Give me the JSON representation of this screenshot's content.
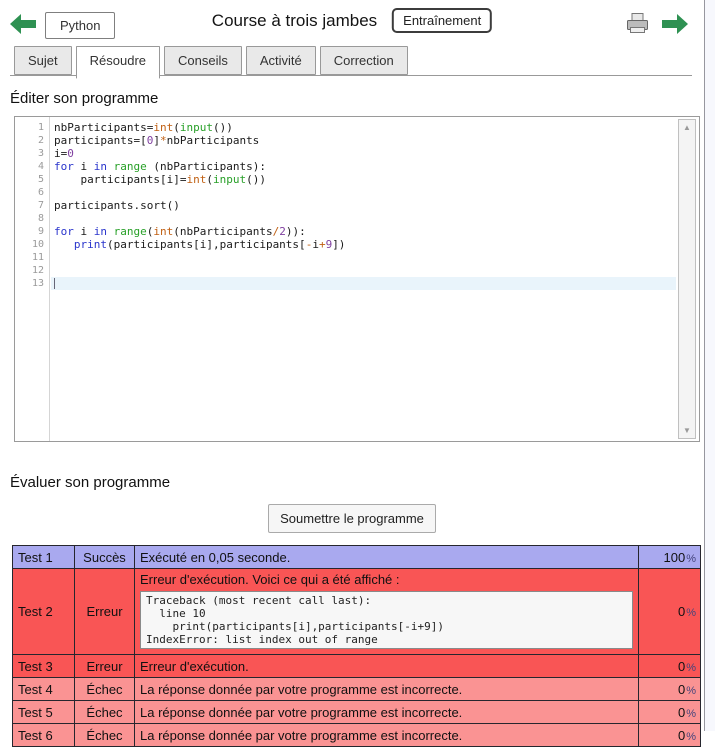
{
  "header": {
    "python_label": "Python",
    "title": "Course à trois jambes",
    "badge": "Entraînement"
  },
  "tabs": [
    {
      "label": "Sujet",
      "active": false
    },
    {
      "label": "Résoudre",
      "active": true
    },
    {
      "label": "Conseils",
      "active": false
    },
    {
      "label": "Activité",
      "active": false
    },
    {
      "label": "Correction",
      "active": false
    }
  ],
  "sections": {
    "edit": "Éditer son programme",
    "evaluate": "Évaluer son programme"
  },
  "editor": {
    "active_line": 13,
    "scroll_up": "▲",
    "scroll_down": "▼",
    "lines": [
      [
        [
          "pl",
          "nbParticipants="
        ],
        [
          "ty",
          "int"
        ],
        [
          "pl",
          "("
        ],
        [
          "fn",
          "input"
        ],
        [
          "pl",
          "())"
        ]
      ],
      [
        [
          "pl",
          "participants=["
        ],
        [
          "nu",
          "0"
        ],
        [
          "pl",
          "]"
        ],
        [
          "op",
          "*"
        ],
        [
          "pl",
          "nbParticipants"
        ]
      ],
      [
        [
          "pl",
          "i="
        ],
        [
          "nu",
          "0"
        ]
      ],
      [
        [
          "kw",
          "for"
        ],
        [
          "pl",
          " i "
        ],
        [
          "kw",
          "in"
        ],
        [
          "pl",
          " "
        ],
        [
          "fn",
          "range"
        ],
        [
          "pl",
          " (nbParticipants):"
        ]
      ],
      [
        [
          "pl",
          "    participants[i]="
        ],
        [
          "ty",
          "int"
        ],
        [
          "pl",
          "("
        ],
        [
          "fn",
          "input"
        ],
        [
          "pl",
          "())"
        ]
      ],
      [],
      [
        [
          "pl",
          "participants.sort()"
        ]
      ],
      [],
      [
        [
          "kw",
          "for"
        ],
        [
          "pl",
          " i "
        ],
        [
          "kw",
          "in"
        ],
        [
          "pl",
          " "
        ],
        [
          "fn",
          "range"
        ],
        [
          "pl",
          "("
        ],
        [
          "ty",
          "int"
        ],
        [
          "pl",
          "(nbParticipants"
        ],
        [
          "op",
          "/"
        ],
        [
          "nu",
          "2"
        ],
        [
          "pl",
          ")):"
        ]
      ],
      [
        [
          "pl",
          "   "
        ],
        [
          "kw",
          "print"
        ],
        [
          "pl",
          "(participants[i],participants["
        ],
        [
          "op",
          "-"
        ],
        [
          "pl",
          "i"
        ],
        [
          "op",
          "+"
        ],
        [
          "nu",
          "9"
        ],
        [
          "pl",
          "])"
        ]
      ],
      [],
      [],
      []
    ]
  },
  "submit_button": "Soumettre le programme",
  "results": {
    "percent_sign": "%",
    "rows": [
      {
        "test": "Test 1",
        "status": "Succès",
        "type": "success",
        "message": "Exécuté en 0,05 seconde.",
        "score": "100"
      },
      {
        "test": "Test 2",
        "status": "Erreur",
        "type": "error",
        "message": "Erreur d'exécution. Voici ce qui a été affiché :",
        "traceback": [
          "Traceback (most recent call last):",
          "  line 10",
          "    print(participants[i],participants[-i+9])",
          "IndexError: list index out of range"
        ],
        "score": "0"
      },
      {
        "test": "Test 3",
        "status": "Erreur",
        "type": "error",
        "message": "Erreur d'exécution.",
        "score": "0"
      },
      {
        "test": "Test 4",
        "status": "Échec",
        "type": "failure",
        "message": "La réponse donnée par votre programme est incorrecte.",
        "score": "0"
      },
      {
        "test": "Test 5",
        "status": "Échec",
        "type": "failure",
        "message": "La réponse donnée par votre programme est incorrecte.",
        "score": "0"
      },
      {
        "test": "Test 6",
        "status": "Échec",
        "type": "failure",
        "message": "La réponse donnée par votre programme est incorrecte.",
        "score": "0"
      }
    ]
  },
  "colors": {
    "accent_green": "#2e9152",
    "success_row_bg": "#a9a9ef",
    "error_row_bg": "#f95555",
    "failure_row_bg": "#fa9393",
    "active_line_bg": "#e9f4fb"
  }
}
